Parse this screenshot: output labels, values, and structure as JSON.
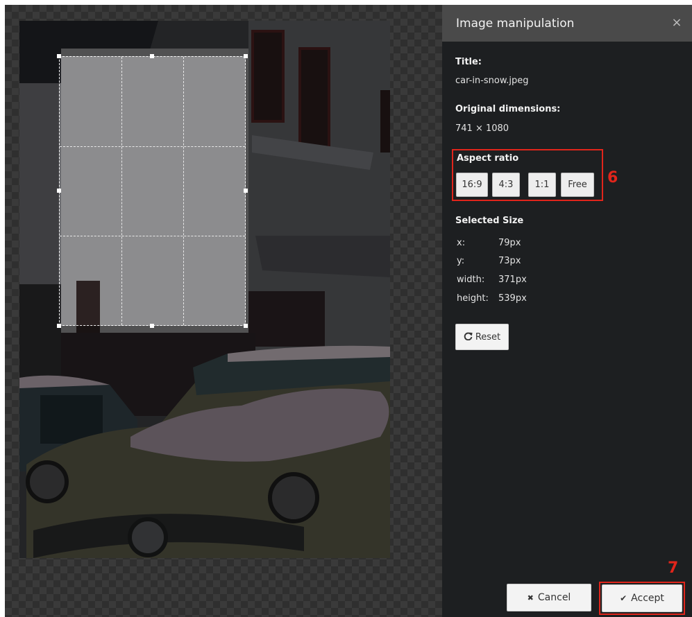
{
  "panel": {
    "title": "Image manipulation",
    "close_icon": "×",
    "title_label": "Title:",
    "title_value": "car-in-snow.jpeg",
    "dimensions_label": "Original dimensions:",
    "dimensions_value": "741 × 1080"
  },
  "aspect_ratio": {
    "label": "Aspect ratio",
    "options": [
      "16:9",
      "4:3",
      "1:1",
      "Free"
    ],
    "marker": "6"
  },
  "selected_size": {
    "label": "Selected Size",
    "rows": [
      {
        "key": "x:",
        "value": "79px"
      },
      {
        "key": "y:",
        "value": "73px"
      },
      {
        "key": "width:",
        "value": "371px"
      },
      {
        "key": "height:",
        "value": "539px"
      }
    ]
  },
  "reset": {
    "icon": "refresh-icon",
    "label": "Reset"
  },
  "footer": {
    "cancel_label": "Cancel",
    "cancel_icon": "✖",
    "accept_label": "Accept",
    "accept_icon": "✔",
    "marker": "7"
  },
  "colors": {
    "highlight": "#e1251b",
    "panel_bg": "#1d1f21",
    "header_bg": "#4a4a4a"
  }
}
